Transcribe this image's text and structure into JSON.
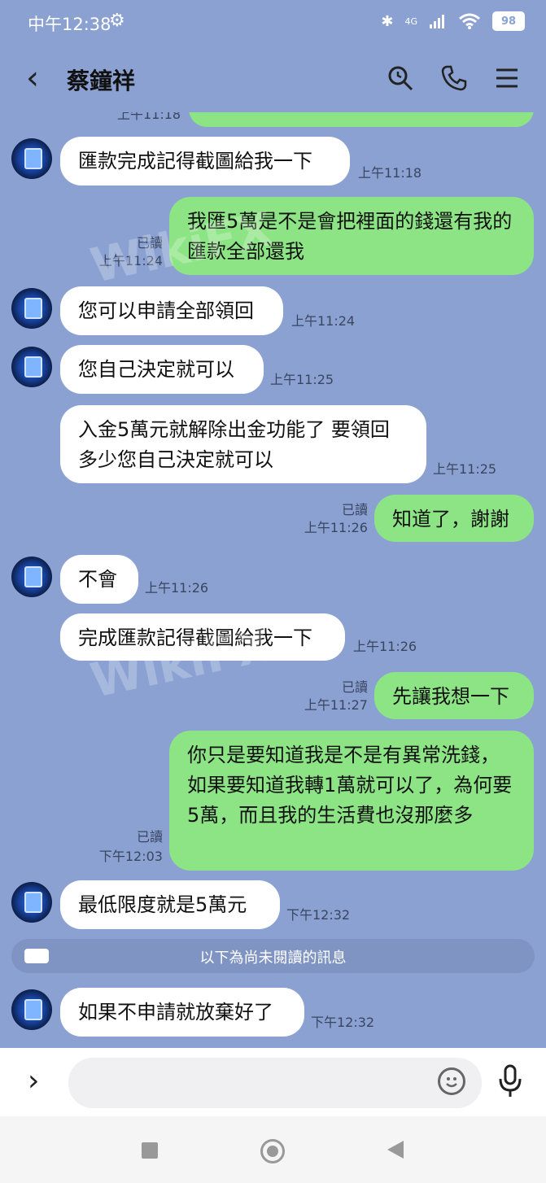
{
  "status_bar": {
    "time": "中午12:38",
    "network": "4G",
    "battery": "98"
  },
  "header": {
    "title": "蔡鐘祥",
    "icons": [
      "back-arrow-icon",
      "search-icon",
      "phone-icon",
      "menu-icon"
    ]
  },
  "messages": [
    {
      "side": "in",
      "text": "匯款完成記得截圖給我一下",
      "time": "上午11:18"
    },
    {
      "side": "out",
      "text": "我匯5萬是不是會把裡面的錢還有我的匯款全部還我",
      "read": "已讀",
      "time": "上午11:24"
    },
    {
      "side": "in",
      "text": "您可以申請全部領回",
      "time": "上午11:24"
    },
    {
      "side": "in",
      "text": "您自己決定就可以",
      "time": "上午11:25"
    },
    {
      "side": "in",
      "text": "入金5萬元就解除出金功能了 要領回多少您自己決定就可以",
      "time": "上午11:25"
    },
    {
      "side": "out",
      "text": "知道了，謝謝",
      "read": "已讀",
      "time": "上午11:26"
    },
    {
      "side": "in",
      "text": "不會",
      "time": "上午11:26"
    },
    {
      "side": "in",
      "text": "完成匯款記得截圖給我一下",
      "time": "上午11:26"
    },
    {
      "side": "out",
      "text": "先讓我想一下",
      "read": "已讀",
      "time": "上午11:27"
    },
    {
      "side": "out",
      "text": "你只是要知道我是不是有異常洗錢，如果要知道我轉1萬就可以了，為何要5萬，而且我的生活費也沒那麼多",
      "read": "已讀",
      "time": "下午12:03"
    },
    {
      "side": "in",
      "text": "最低限度就是5萬元",
      "time": "下午12:32"
    },
    {
      "side": "in",
      "text": "如果不申請就放棄好了",
      "time": "下午12:32"
    }
  ],
  "partial_top": {
    "time": "上午11:18"
  },
  "unread_divider": "以下為尚未閱讀的訊息",
  "input": {
    "placeholder": ""
  },
  "watermark": "WikiFX",
  "colors": {
    "background": "#8aa1d2",
    "outgoing": "#8de485",
    "incoming": "#ffffff"
  }
}
